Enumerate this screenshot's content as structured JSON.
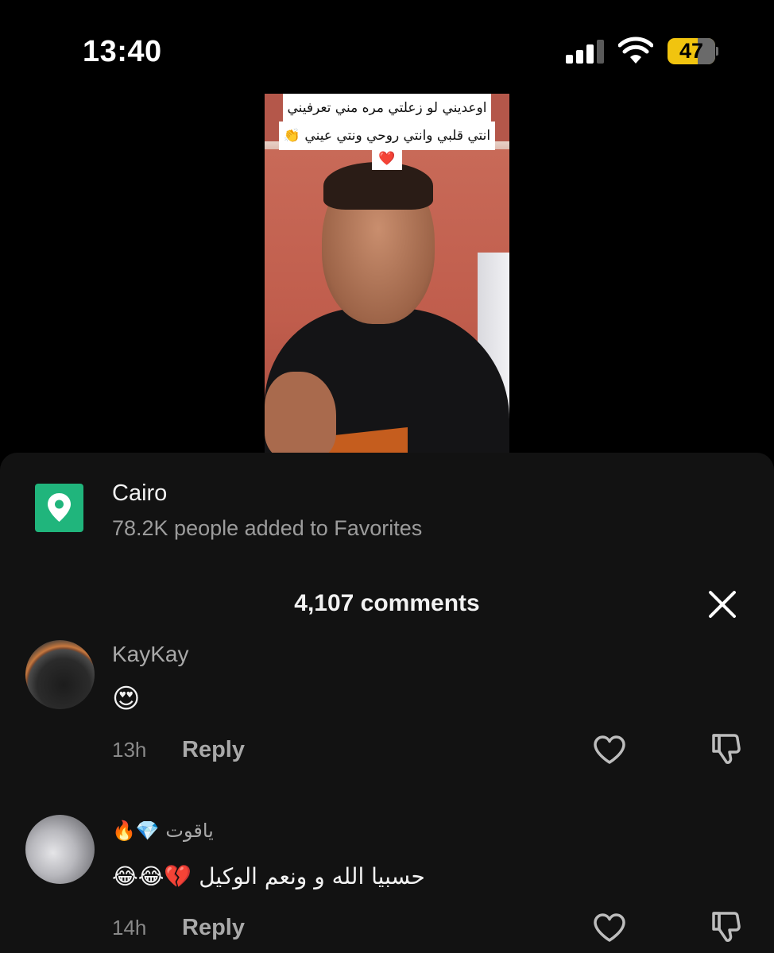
{
  "status_bar": {
    "time": "13:40",
    "battery": "47",
    "battery_color": "#f1c40f",
    "signal_icon": "cellular-signal-icon",
    "wifi_icon": "wifi-icon"
  },
  "video": {
    "caption_line1": "اوعديني لو زعلتي مره مني تعرفيني",
    "caption_line2": "انتي قلبي وانتي روحي ونتي عيني 👏",
    "caption_line3": "❤️"
  },
  "location": {
    "icon": "location-pin-icon",
    "icon_color": "#20b57c",
    "title": "Cairo",
    "subtitle": "78.2K people added to Favorites"
  },
  "comments_header": {
    "count_label": "4,107 comments",
    "close_icon": "close-icon"
  },
  "comments": [
    {
      "username": "KayKay",
      "text": "😍",
      "time": "13h",
      "reply_label": "Reply"
    },
    {
      "username": "ياقوت 💎🔥",
      "text": "حسبيا الله و ونعم الوكيل 💔😂😂",
      "time": "14h",
      "reply_label": "Reply"
    }
  ]
}
